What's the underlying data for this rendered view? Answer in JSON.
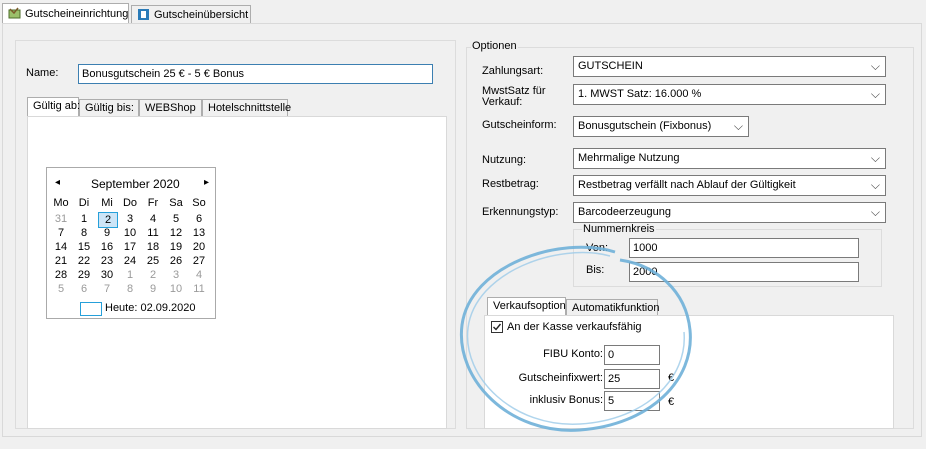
{
  "top_tabs": [
    {
      "label": "Gutscheineinrichtung",
      "icon": "voucher-setup-icon",
      "active": true
    },
    {
      "label": "Gutscheinübersicht",
      "icon": "voucher-overview-icon",
      "active": false
    }
  ],
  "left": {
    "name_label": "Name:",
    "name_value": "Bonusgutschein 25 € - 5 € Bonus",
    "tabs": [
      "Gültig ab:",
      "Gültig bis:",
      "WEBShop",
      "Hotelschnittstelle"
    ],
    "calendar": {
      "month_label": "September 2020",
      "prev": "◂",
      "next": "▸",
      "weekdays": [
        "Mo",
        "Di",
        "Mi",
        "Do",
        "Fr",
        "Sa",
        "So"
      ],
      "weeks": [
        [
          "31",
          "1",
          "2",
          "3",
          "4",
          "5",
          "6"
        ],
        [
          "7",
          "8",
          "9",
          "10",
          "11",
          "12",
          "13"
        ],
        [
          "14",
          "15",
          "16",
          "17",
          "18",
          "19",
          "20"
        ],
        [
          "21",
          "22",
          "23",
          "24",
          "25",
          "26",
          "27"
        ],
        [
          "28",
          "29",
          "30",
          "1",
          "2",
          "3",
          "4"
        ],
        [
          "5",
          "6",
          "7",
          "8",
          "9",
          "10",
          "11"
        ]
      ],
      "selected_day": "2",
      "today_label": "Heute: 02.09.2020"
    }
  },
  "options": {
    "group_label": "Optionen",
    "zahlungsart_label": "Zahlungsart:",
    "zahlungsart_value": "GUTSCHEIN",
    "mwst_label_1": "MwstSatz für",
    "mwst_label_2": "Verkauf:",
    "mwst_value": "1. MWST Satz: 16.000 %",
    "form_label": "Gutscheinform:",
    "form_value": "Bonusgutschein (Fixbonus)",
    "nutzung_label": "Nutzung:",
    "nutzung_value": "Mehrmalige Nutzung",
    "rest_label": "Restbetrag:",
    "rest_value": "Restbetrag verfällt nach Ablauf der Gültigkeit",
    "erkennung_label": "Erkennungstyp:",
    "erkennung_value": "Barcodeerzeugung",
    "nummernkreis_label": "Nummernkreis",
    "von_label": "Von:",
    "von_value": "1000",
    "bis_label": "Bis:",
    "bis_value": "2000",
    "sub_tabs": [
      "Verkaufsoption",
      "Automatikfunktion"
    ],
    "checkbox_label": "An der Kasse verkaufsfähig",
    "checkbox_checked": true,
    "fibu_label": "FIBU Konto:",
    "fibu_value": "0",
    "fixwert_label": "Gutscheinfixwert:",
    "fixwert_value": "25",
    "bonus_label": "inklusiv Bonus:",
    "bonus_value": "5",
    "currency": "€"
  },
  "colors": {
    "highlight_circle": "#6fb0d8",
    "selected_day_bg": "#cde5f7"
  }
}
